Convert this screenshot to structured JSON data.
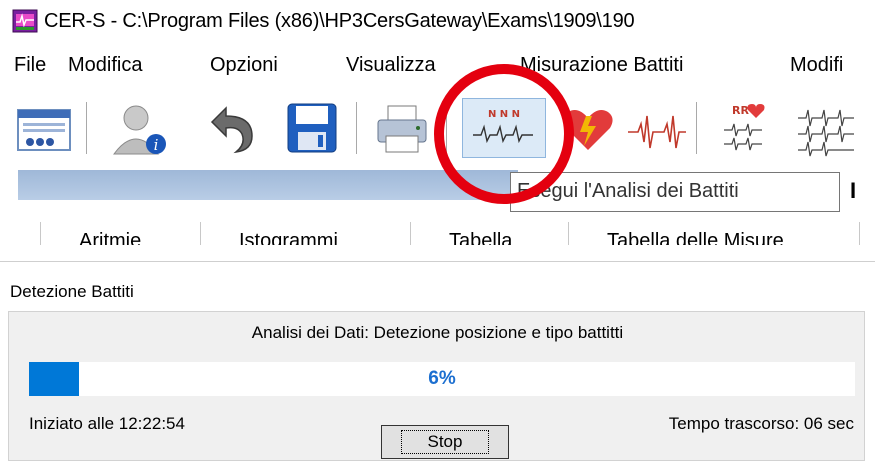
{
  "window": {
    "title": "CER-S - C:\\Program Files (x86)\\HP3CersGateway\\Exams\\1909\\190",
    "app_icon": "cer-s-app-icon"
  },
  "menu": {
    "items": [
      "File",
      "Modifica",
      "Opzioni",
      "Visualizza",
      "Misurazione Battiti",
      "Modifi"
    ]
  },
  "toolbar": {
    "buttons": [
      {
        "icon": "patient-list-icon"
      },
      {
        "icon": "patient-info-icon"
      },
      {
        "icon": "undo-icon"
      },
      {
        "icon": "save-icon"
      },
      {
        "icon": "print-icon"
      },
      {
        "icon": "beat-analysis-icon",
        "label": "N N N",
        "active": true
      },
      {
        "icon": "heart-alert-icon"
      },
      {
        "icon": "ecg-trace-icon"
      },
      {
        "icon": "rr-analysis-icon",
        "label": "RR"
      },
      {
        "icon": "multi-ecg-icon"
      }
    ]
  },
  "tooltip": {
    "text": "Esegui l'Analisi dei Battiti"
  },
  "tabs": [
    "Aritmie",
    "Istogrammi",
    "Tabella",
    "Tabella delle Misure"
  ],
  "dialog": {
    "title": "Detezione Battiti",
    "analysis_text": "Analisi dei Dati: Detezione posizione e tipo battitti",
    "progress_percent": 6,
    "progress_label": "6%",
    "started_text": "Iniziato alle 12:22:54",
    "elapsed_text": "Tempo trascorso: 06 sec",
    "stop_label": "Stop"
  },
  "colors": {
    "annotation": "#e4000f",
    "progress_fill": "#0078d7",
    "progress_text": "#1c6fd0"
  }
}
